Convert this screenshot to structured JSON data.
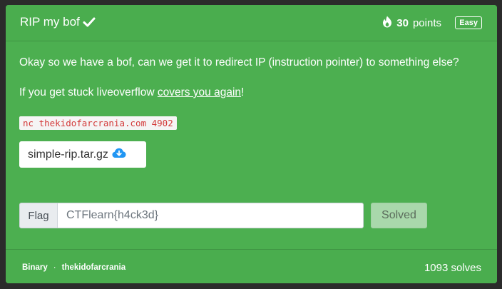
{
  "header": {
    "title": "RIP my bof",
    "points_value": "30",
    "points_label": "points",
    "difficulty": "Easy"
  },
  "description": {
    "line1": "Okay so we have a bof, can we get it to redirect IP (instruction pointer) to something else?",
    "line2_prefix": "If you get stuck liveoverflow ",
    "line2_link": "covers you again",
    "line2_suffix": "!",
    "command": "nc thekidofarcrania.com 4902"
  },
  "file": {
    "name": "simple-rip.tar.gz",
    "icon": "cloud-download-icon"
  },
  "flag": {
    "label": "Flag",
    "value": "CTFlearn{h4ck3d}",
    "submit_label": "Solved"
  },
  "footer": {
    "category": "Binary",
    "separator": "·",
    "author": "thekidofarcrania",
    "solves": "1093 solves"
  },
  "colors": {
    "card": "#4caf50",
    "background": "#2b2b2b",
    "code_text": "#d33a3a",
    "download_icon": "#2196f3"
  }
}
